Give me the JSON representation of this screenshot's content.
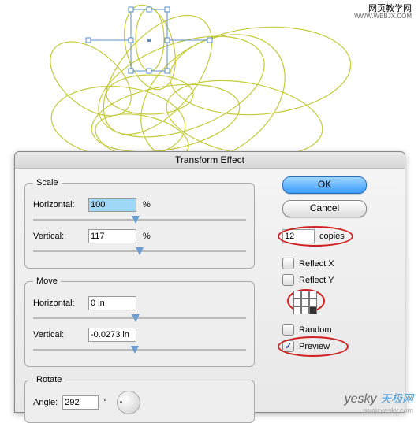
{
  "watermark_top": {
    "line1": "网页教学网",
    "line2": "WWW.WEBJX.COM"
  },
  "watermark_bottom": {
    "logo": "yesky",
    "url": "www.yesky.com",
    "cn": "天极网"
  },
  "dialog": {
    "title": "Transform Effect"
  },
  "scale": {
    "legend": "Scale",
    "h_label": "Horizontal:",
    "h_value": "100",
    "h_unit": "%",
    "v_label": "Vertical:",
    "v_value": "117",
    "v_unit": "%"
  },
  "move": {
    "legend": "Move",
    "h_label": "Horizontal:",
    "h_value": "0 in",
    "v_label": "Vertical:",
    "v_value": "-0.0273 in"
  },
  "rotate": {
    "legend": "Rotate",
    "a_label": "Angle:",
    "a_value": "292",
    "a_unit": "°"
  },
  "buttons": {
    "ok": "OK",
    "cancel": "Cancel"
  },
  "copies": {
    "value": "12",
    "label": "copies"
  },
  "checks": {
    "reflect_x": "Reflect X",
    "reflect_y": "Reflect Y",
    "random": "Random",
    "preview": "Preview"
  }
}
